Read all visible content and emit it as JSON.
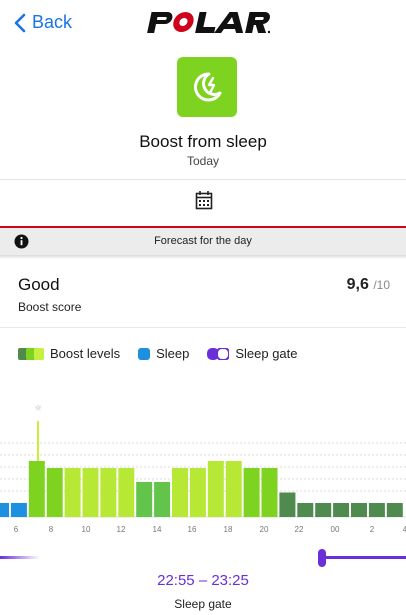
{
  "header": {
    "back_label": "Back",
    "logo_text": "POLAR"
  },
  "page": {
    "title": "Boost from sleep",
    "subtitle": "Today",
    "icon": "moon-bolt-icon",
    "icon_color": "#7ed321"
  },
  "forecast": {
    "label": "Forecast for the day"
  },
  "boost": {
    "rating": "Good",
    "rating_label": "Boost score",
    "score": "9,6",
    "score_max": "/10"
  },
  "legend": {
    "boost_levels": "Boost levels",
    "sleep": "Sleep",
    "sleep_gate": "Sleep gate"
  },
  "colors": {
    "sleep": "#1e90e0",
    "sleep_gate": "#6a2fd6",
    "accent_red": "#d0021b"
  },
  "chart_data": {
    "type": "bar",
    "x_tick_labels": [
      "6",
      "8",
      "10",
      "12",
      "14",
      "16",
      "18",
      "20",
      "22",
      "00",
      "2",
      "4"
    ],
    "sunrise_marker": "6:45",
    "series": [
      {
        "values": [
          {
            "value": 2,
            "kind": "sleep"
          },
          {
            "value": 2,
            "kind": "sleep"
          },
          {
            "value": 8,
            "kind": "medium"
          },
          {
            "value": 7,
            "kind": "medium"
          },
          {
            "value": 7,
            "kind": "light"
          },
          {
            "value": 7,
            "kind": "light"
          },
          {
            "value": 7,
            "kind": "light"
          },
          {
            "value": 7,
            "kind": "light"
          },
          {
            "value": 5,
            "kind": "green"
          },
          {
            "value": 5,
            "kind": "green"
          },
          {
            "value": 7,
            "kind": "light"
          },
          {
            "value": 7,
            "kind": "light"
          },
          {
            "value": 8,
            "kind": "light"
          },
          {
            "value": 8,
            "kind": "light"
          },
          {
            "value": 7,
            "kind": "medium"
          },
          {
            "value": 7,
            "kind": "medium"
          },
          {
            "value": 3.5,
            "kind": "dark"
          },
          {
            "value": 2,
            "kind": "dark"
          },
          {
            "value": 2,
            "kind": "dark"
          },
          {
            "value": 2,
            "kind": "dark"
          },
          {
            "value": 2,
            "kind": "dark"
          },
          {
            "value": 2,
            "kind": "dark"
          },
          {
            "value": 2,
            "kind": "dark"
          }
        ]
      }
    ],
    "ylim": [
      0,
      10
    ]
  },
  "sleep_gate": {
    "time_range": "22:55 – 23:25",
    "label": "Sleep gate"
  }
}
